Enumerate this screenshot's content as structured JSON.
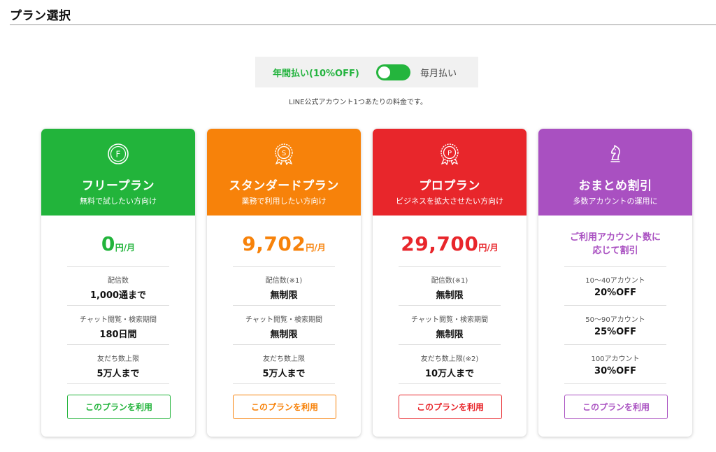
{
  "header": {
    "title": "プラン選択"
  },
  "billing": {
    "annual_label": "年間払い(10%OFF)",
    "monthly_label": "毎月払い",
    "note": "LINE公式アカウント1つあたりの料金です。"
  },
  "plans": [
    {
      "icon": "f-badge-icon",
      "name": "フリープラン",
      "subtitle": "無料で試したい方向け",
      "price": "0",
      "price_unit": "円/月",
      "color": "#22b43b",
      "specs": [
        {
          "label": "配信数",
          "value": "1,000通まで"
        },
        {
          "label": "チャット閲覧・検索期間",
          "value": "180日間"
        },
        {
          "label": "友だち数上限",
          "value": "5万人まで"
        }
      ],
      "cta": "このプランを利用"
    },
    {
      "icon": "s-medal-icon",
      "name": "スタンダードプラン",
      "subtitle": "業務で利用したい方向け",
      "price": "9,702",
      "price_unit": "円/月",
      "color": "#f7820a",
      "specs": [
        {
          "label": "配信数(※1)",
          "value": "無制限"
        },
        {
          "label": "チャット閲覧・検索期間",
          "value": "無制限"
        },
        {
          "label": "友だち数上限",
          "value": "5万人まで"
        }
      ],
      "cta": "このプランを利用"
    },
    {
      "icon": "p-medal-icon",
      "name": "プロプラン",
      "subtitle": "ビジネスを拡大させたい方向け",
      "price": "29,700",
      "price_unit": "円/月",
      "color": "#e8262b",
      "specs": [
        {
          "label": "配信数(※1)",
          "value": "無制限"
        },
        {
          "label": "チャット閲覧・検索期間",
          "value": "無制限"
        },
        {
          "label": "友だち数上限(※2)",
          "value": "10万人まで"
        }
      ],
      "cta": "このプランを利用"
    },
    {
      "icon": "chess-knight-icon",
      "name": "おまとめ割引",
      "subtitle": "多数アカウントの運用に",
      "headline": [
        "ご利用アカウント数に",
        "応じて割引"
      ],
      "color": "#a950c1",
      "specs": [
        {
          "label": "10〜40アカウント",
          "value": "20%OFF"
        },
        {
          "label": "50〜90アカウント",
          "value": "25%OFF"
        },
        {
          "label": "100アカウント",
          "value": "30%OFF"
        }
      ],
      "cta": "このプランを利用"
    }
  ]
}
